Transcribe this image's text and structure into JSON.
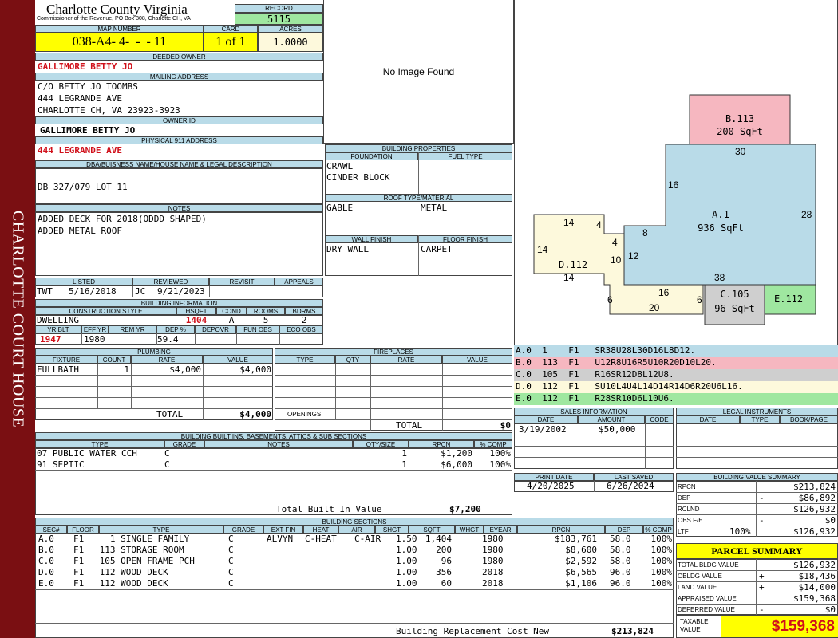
{
  "sidebar": {
    "text": "CHARLOTTE COURT HOUSE"
  },
  "header": {
    "county": "Charlotte County Virginia",
    "office": "Commissioner of the Revenue, PO Box 308, Charlotte CH, VA",
    "record_label": "RECORD",
    "record_value": "5115",
    "map_label": "MAP NUMBER",
    "map_value": "038-A4- 4-  -  - 11",
    "card_label": "CARD",
    "card_value": "1 of 1",
    "acres_label": "ACRES",
    "acres_value": "1.0000"
  },
  "owner": {
    "deeded_label": "DEEDED OWNER",
    "deeded_value": "GALLIMORE BETTY JO",
    "mailing_label": "MAILING ADDRESS",
    "mailing_lines": [
      "C/O BETTY JO TOOMBS",
      "444 LEGRANDE AVE",
      "CHARLOTTE CH, VA 23923-3923"
    ],
    "owner_id_label": "OWNER ID",
    "owner_id_value": "GALLIMORE BETTY JO",
    "physical_label": "PHYSICAL 911 ADDRESS",
    "physical_value": "444 LEGRANDE AVE",
    "dba_label": "DBA/BUISNESS NAME/HOUSE NAME & LEGAL DESCRIPTION",
    "dba_value": "DB 327/079 LOT 11",
    "notes_label": "NOTES",
    "notes_lines": [
      "ADDED DECK FOR 2018(ODDD SHAPED)",
      "ADDED METAL ROOF"
    ]
  },
  "image": {
    "placeholder": "No Image Found"
  },
  "building_properties": {
    "title": "BUILDING PROPERTIES",
    "foundation_label": "FOUNDATION",
    "foundation_lines": [
      "CRAWL",
      "CINDER BLOCK"
    ],
    "fuel_label": "FUEL TYPE",
    "fuel_value": "",
    "roof_label": "ROOF TYPE/MATERIAL",
    "roof_type": "GABLE",
    "roof_material": "METAL",
    "wall_label": "WALL FINISH",
    "wall_value": "DRY WALL",
    "floor_label": "FLOOR FINISH",
    "floor_value": "CARPET"
  },
  "listing": {
    "headers": [
      "LISTED",
      "REVIEWED",
      "REVISIT",
      "APPEALS"
    ],
    "listed_by": "TWT",
    "listed_date": "5/16/2018",
    "reviewed_by": "JC",
    "reviewed_date": "9/21/2023"
  },
  "building_info": {
    "title": "BUILDING INFORMATION",
    "headers": [
      "CONSTRUCTION STYLE",
      "HSQFT",
      "COND",
      "ROOMS",
      "BDRMS"
    ],
    "style": "DWELLING",
    "hsqft": "1404",
    "cond": "A",
    "rooms": "5",
    "bdrms": "2",
    "headers2": [
      "YR BLT",
      "EFF YR",
      "REM YR",
      "DEP %",
      "DEPOVR",
      "FUN OBS",
      "ECO OBS"
    ],
    "yr_blt": "1947",
    "eff_yr": "1980",
    "rem_yr": "",
    "dep": "59.4"
  },
  "plumbing": {
    "title": "PLUMBING",
    "headers": [
      "FIXTURE",
      "COUNT",
      "RATE",
      "VALUE"
    ],
    "rows": [
      {
        "fixture": "FULLBATH",
        "count": "1",
        "rate": "$4,000",
        "value": "$4,000"
      }
    ],
    "total_label": "TOTAL",
    "total_value": "$4,000"
  },
  "fireplaces": {
    "title": "FIREPLACES",
    "headers": [
      "TYPE",
      "QTY",
      "RATE",
      "VALUE"
    ],
    "openings_label": "OPENINGS",
    "total_label": "TOTAL",
    "total_value": "$0"
  },
  "builtins": {
    "title": "BUILDING BUILT INS, BASEMENTS, ATTICS & SUB SECTIONS",
    "headers": [
      "TYPE",
      "GRADE",
      "NOTES",
      "QTY/SIZE",
      "RPCN",
      "% COMP"
    ],
    "rows": [
      {
        "type": "07 PUBLIC WATER CCH",
        "grade": "C",
        "qty": "1",
        "rpcn": "$1,200",
        "comp": "100%"
      },
      {
        "type": "91 SEPTIC",
        "grade": "C",
        "qty": "1",
        "rpcn": "$6,000",
        "comp": "100%"
      }
    ],
    "total_label": "Total Built In Value",
    "total_value": "$7,200"
  },
  "sketch": {
    "areas": [
      {
        "code": "A.1",
        "area": "936 SqFt"
      },
      {
        "code": "B.113",
        "area": "200 SqFt"
      },
      {
        "code": "C.105",
        "area": "96 SqFt"
      },
      {
        "code": "D.112",
        "area": ""
      },
      {
        "code": "E.112",
        "area": ""
      }
    ],
    "dims": [
      "30",
      "16",
      "28",
      "8",
      "12",
      "4",
      "14",
      "4",
      "10",
      "14",
      "14",
      "38",
      "16",
      "6",
      "20",
      "6"
    ]
  },
  "vectors": [
    {
      "text": "A.0  1    F1   SR38U28L30D16L8D12.",
      "color": "#b9dbe8"
    },
    {
      "text": "B.0  113  F1   U12R8U16R5U10R20D10L20.",
      "color": "#f6b7c0"
    },
    {
      "text": "C.0  105  F1   R16SR12D8L12U8.",
      "color": "#cfcfcf"
    },
    {
      "text": "D.0  112  F1   SU10L4U4L14D14R14D6R20U6L16.",
      "color": "#fdf9dc"
    },
    {
      "text": "E.0  112  F1   R28SR10D6L10U6.",
      "color": "#9fe7a0"
    }
  ],
  "sales": {
    "title": "SALES INFORMATION",
    "headers": [
      "DATE",
      "AMOUNT",
      "CODE"
    ],
    "rows": [
      {
        "date": "3/19/2002",
        "amount": "$50,000",
        "code": ""
      }
    ]
  },
  "legal": {
    "title": "LEGAL INSTRUMENTS",
    "headers": [
      "DATE",
      "TYPE",
      "BOOK/PAGE"
    ]
  },
  "print": {
    "print_label": "PRINT DATE",
    "print_value": "4/20/2025",
    "saved_label": "LAST SAVED",
    "saved_value": "6/26/2024"
  },
  "bvs": {
    "title": "BUILDING VALUE SUMMARY",
    "rows": [
      {
        "label": "RPCN",
        "sign": "",
        "value": "$213,824"
      },
      {
        "label": "DEP",
        "sign": "-",
        "value": "$86,892"
      },
      {
        "label": "RCLND",
        "sign": "",
        "value": "$126,932"
      },
      {
        "label": "OBS F/E",
        "sign": "-",
        "value": "$0"
      },
      {
        "label": "LTF",
        "pct": "100%",
        "sign": "",
        "value": "$126,932"
      }
    ]
  },
  "parcel": {
    "title": "PARCEL SUMMARY",
    "rows": [
      {
        "label": "TOTAL BLDG VALUE",
        "sign": "",
        "value": "$126,932"
      },
      {
        "label": "OBLDG VALUE",
        "sign": "+",
        "value": "$18,436"
      },
      {
        "label": "LAND VALUE",
        "sign": "+",
        "value": "$14,000"
      },
      {
        "label": "APPRAISED VALUE",
        "sign": "",
        "value": "$159,368"
      },
      {
        "label": "DEFERRED VALUE",
        "sign": "-",
        "value": "$0"
      }
    ],
    "taxable_label": "TAXABLE VALUE",
    "taxable_value": "$159,368"
  },
  "sections": {
    "title": "BUILDING SECTIONS",
    "headers": [
      "SEC#",
      "FLOOR",
      "TYPE",
      "GRADE",
      "EXT FIN",
      "HEAT",
      "AIR",
      "SHGT",
      "SQFT",
      "WHGT",
      "EYEAR",
      "RPCN",
      "DEP",
      "% COMP"
    ],
    "rows": [
      {
        "sec": "A.0",
        "floor": "F1",
        "type": "   1 SINGLE FAMILY",
        "grade": "C",
        "ext": "ALVYN",
        "heat": "C-HEAT",
        "air": "C-AIR",
        "shgt": "1.50",
        "sqft": "1,404",
        "whgt": "",
        "eyear": "1980",
        "rpcn": "$183,761",
        "dep": "58.0",
        "comp": "100%"
      },
      {
        "sec": "B.0",
        "floor": "F1",
        "type": " 113 STORAGE ROOM",
        "grade": "C",
        "ext": "",
        "heat": "",
        "air": "",
        "shgt": "1.00",
        "sqft": "200",
        "whgt": "",
        "eyear": "1980",
        "rpcn": "$8,600",
        "dep": "58.0",
        "comp": "100%"
      },
      {
        "sec": "C.0",
        "floor": "F1",
        "type": " 105 OPEN FRAME PCH",
        "grade": "C",
        "ext": "",
        "heat": "",
        "air": "",
        "shgt": "1.00",
        "sqft": "96",
        "whgt": "",
        "eyear": "1980",
        "rpcn": "$2,592",
        "dep": "58.0",
        "comp": "100%"
      },
      {
        "sec": "D.0",
        "floor": "F1",
        "type": " 112 WOOD DECK",
        "grade": "C",
        "ext": "",
        "heat": "",
        "air": "",
        "shgt": "1.00",
        "sqft": "356",
        "whgt": "",
        "eyear": "2018",
        "rpcn": "$6,565",
        "dep": "96.0",
        "comp": "100%"
      },
      {
        "sec": "E.0",
        "floor": "F1",
        "type": " 112 WOOD DECK",
        "grade": "C",
        "ext": "",
        "heat": "",
        "air": "",
        "shgt": "1.00",
        "sqft": "60",
        "whgt": "",
        "eyear": "2018",
        "rpcn": "$1,106",
        "dep": "96.0",
        "comp": "100%"
      }
    ],
    "total_label": "Building Replacement Cost New",
    "total_value": "$213,824"
  }
}
